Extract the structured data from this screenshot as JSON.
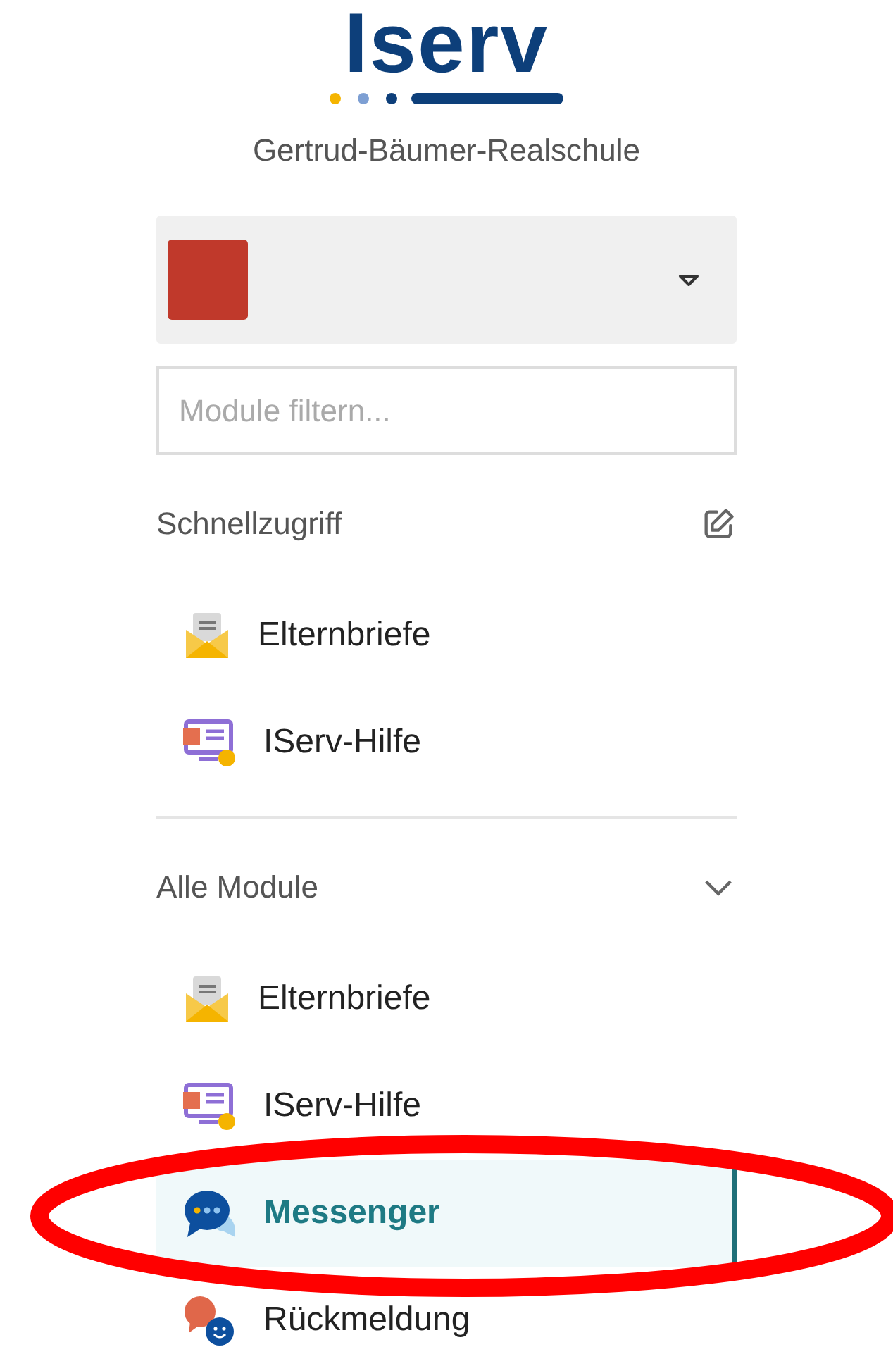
{
  "logo": {
    "text": "Iserv"
  },
  "school_name": "Gertrud-Bäumer-Realschule",
  "filter": {
    "placeholder": "Module filtern..."
  },
  "quick_access": {
    "title": "Schnellzugriff",
    "items": [
      {
        "label": "Elternbriefe",
        "kind": "letter",
        "selected": false
      },
      {
        "label": "IServ-Hilfe",
        "kind": "help",
        "selected": false
      }
    ]
  },
  "all_modules": {
    "title": "Alle Module",
    "expanded": true,
    "items": [
      {
        "label": "Elternbriefe",
        "kind": "letter",
        "selected": false
      },
      {
        "label": "IServ-Hilfe",
        "kind": "help",
        "selected": false
      },
      {
        "label": "Messenger",
        "kind": "chat",
        "selected": true
      },
      {
        "label": "Rückmeldung",
        "kind": "feedback",
        "selected": false
      }
    ]
  },
  "annotations": [
    {
      "kind": "ellipse"
    }
  ]
}
